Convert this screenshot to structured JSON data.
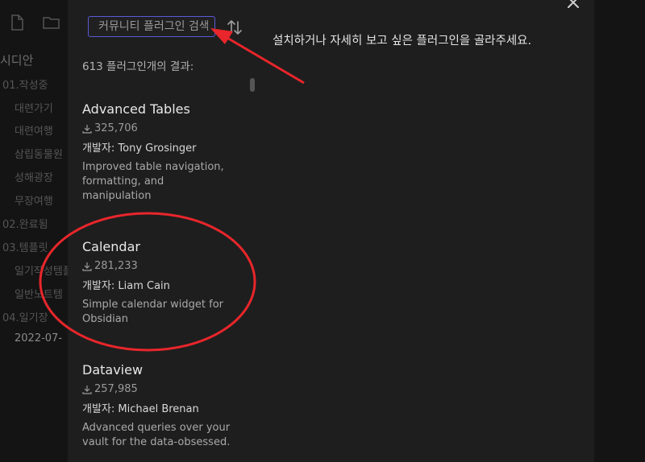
{
  "background": {
    "vault_name": "시디안",
    "tree": [
      {
        "label": "01.작성중",
        "kind": "folder"
      },
      {
        "label": "대련가기",
        "kind": "child"
      },
      {
        "label": "대련여행",
        "kind": "child"
      },
      {
        "label": "삼립동물원",
        "kind": "child"
      },
      {
        "label": "성해광장",
        "kind": "child"
      },
      {
        "label": "무장여행",
        "kind": "child"
      },
      {
        "label": "02.완료됨",
        "kind": "folder"
      },
      {
        "label": "03.템플릿",
        "kind": "folder"
      },
      {
        "label": "일기작성템플",
        "kind": "child"
      },
      {
        "label": "일반노트템",
        "kind": "child"
      },
      {
        "label": "04.일기장",
        "kind": "folder"
      },
      {
        "label": "2022-07-",
        "kind": "date"
      }
    ]
  },
  "search": {
    "placeholder": "커뮤니티 플러그인 검색...",
    "value": ""
  },
  "results": {
    "count_text": "613 플러그인개의 결과:"
  },
  "plugins": [
    {
      "name": "Advanced Tables",
      "downloads": "325,706",
      "author": "개발자: Tony Grosinger",
      "description": "Improved table navigation, formatting, and manipulation"
    },
    {
      "name": "Calendar",
      "downloads": "281,233",
      "author": "개발자: Liam Cain",
      "description": "Simple calendar widget for Obsidian"
    },
    {
      "name": "Dataview",
      "downloads": "257,985",
      "author": "개발자: Michael Brenan",
      "description": "Advanced queries over your vault for the data-obsessed."
    }
  ],
  "detail": {
    "instruction": "설치하거나 자세히 보고 싶은 플러그인을 골라주세요."
  },
  "icons": {
    "file": "file-icon",
    "folder": "folder-icon",
    "sort": "sort-icon",
    "download": "download-icon",
    "close": "close-icon"
  },
  "annotation_color": "#e8262b"
}
